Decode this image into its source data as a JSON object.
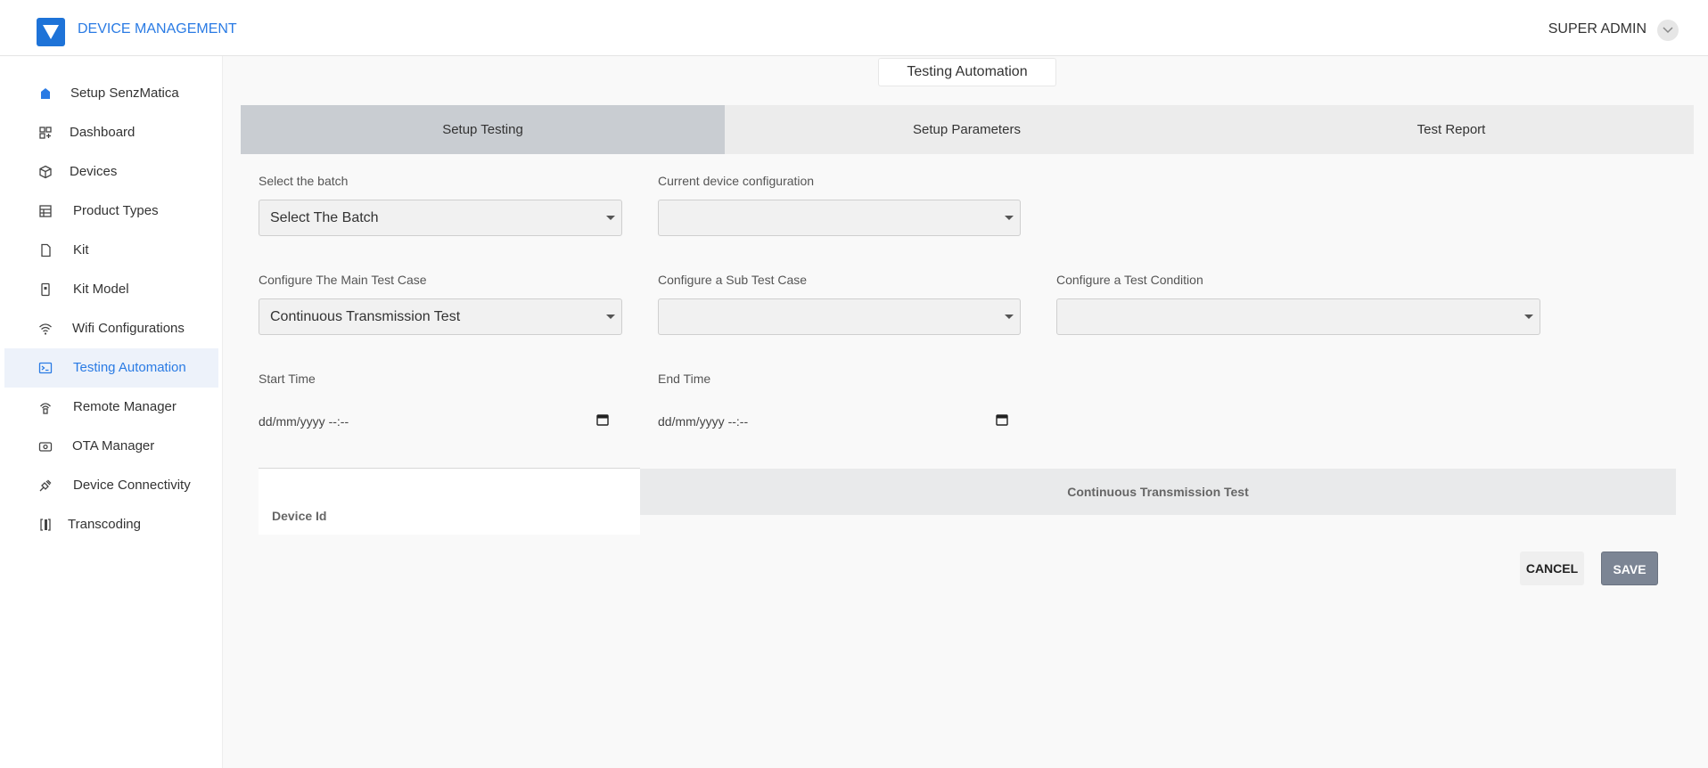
{
  "header": {
    "brand": "DEVICE MANAGEMENT",
    "user": "SUPER ADMIN",
    "accent_color": "#2a7be4"
  },
  "sidebar": {
    "items": [
      {
        "label": "Setup SenzMatica",
        "icon": "package-icon"
      },
      {
        "label": "Dashboard",
        "icon": "dashboard-icon"
      },
      {
        "label": "Devices",
        "icon": "cube-icon"
      },
      {
        "label": "Product Types",
        "icon": "product-types-icon"
      },
      {
        "label": "Kit",
        "icon": "kit-icon"
      },
      {
        "label": "Kit Model",
        "icon": "kit-model-icon"
      },
      {
        "label": "Wifi Configurations",
        "icon": "wifi-icon"
      },
      {
        "label": "Testing Automation",
        "icon": "terminal-icon",
        "active": true
      },
      {
        "label": "Remote Manager",
        "icon": "remote-icon"
      },
      {
        "label": "OTA Manager",
        "icon": "ota-icon"
      },
      {
        "label": "Device Connectivity",
        "icon": "plug-icon"
      },
      {
        "label": "Transcoding",
        "icon": "transcoding-icon"
      }
    ]
  },
  "page": {
    "title": "Testing Automation",
    "tabs": [
      "Setup Testing",
      "Setup Parameters",
      "Test Report"
    ],
    "active_tab": "Setup Testing"
  },
  "form": {
    "batch": {
      "label": "Select the batch",
      "value": "Select The Batch"
    },
    "device_config": {
      "label": "Current device configuration",
      "value": ""
    },
    "main_test_case": {
      "label": "Configure The Main Test Case",
      "value": "Continuous Transmission Test"
    },
    "sub_test_case": {
      "label": "Configure a Sub Test Case",
      "value": ""
    },
    "test_condition": {
      "label": "Configure a Test Condition",
      "value": ""
    },
    "start_time": {
      "label": "Start Time",
      "placeholder": "dd/mm/yyyy --:--"
    },
    "end_time": {
      "label": "End Time",
      "placeholder": "dd/mm/yyyy --:--"
    }
  },
  "table": {
    "device_id_header": "Device Id",
    "test_header": "Continuous Transmission Test"
  },
  "actions": {
    "cancel": "CANCEL",
    "save": "SAVE"
  }
}
